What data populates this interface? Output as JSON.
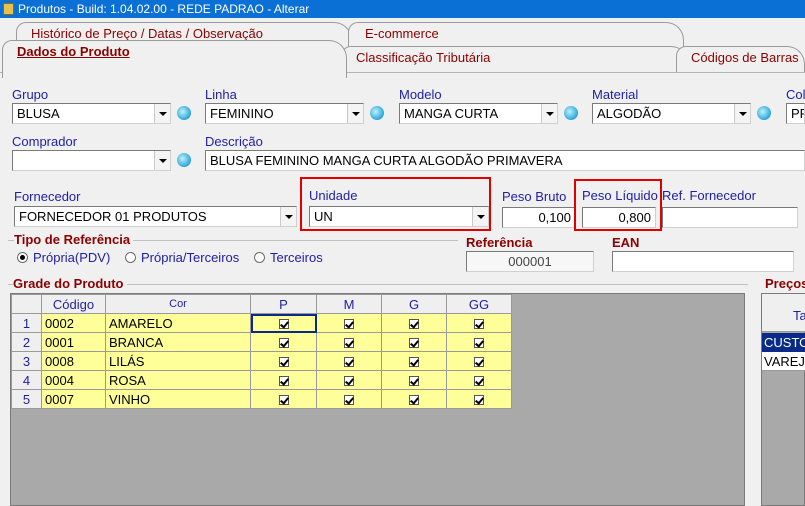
{
  "window": {
    "title": "Produtos - Build: 1.04.02.00 - REDE PADRAO - Alterar"
  },
  "tabs": {
    "historico": "Histórico de Preço / Datas / Observação",
    "ecommerce": "E-commerce",
    "dados": "Dados do Produto",
    "classificacao": "Classificação Tributária",
    "codigos": "Códigos de Barras"
  },
  "fields": {
    "grupo": {
      "label": "Grupo",
      "value": "BLUSA"
    },
    "linha": {
      "label": "Linha",
      "value": "FEMININO"
    },
    "modelo": {
      "label": "Modelo",
      "value": "MANGA CURTA"
    },
    "material": {
      "label": "Material",
      "value": "ALGODÃO"
    },
    "colecao": {
      "label": "Col",
      "value": "PR"
    },
    "comprador": {
      "label": "Comprador",
      "value": ""
    },
    "descricao": {
      "label": "Descrição",
      "value": "BLUSA FEMININO MANGA CURTA ALGODÃO PRIMAVERA"
    },
    "fornecedor": {
      "label": "Fornecedor",
      "value": "FORNECEDOR 01 PRODUTOS"
    },
    "unidade": {
      "label": "Unidade",
      "value": "UN"
    },
    "peso_bruto": {
      "label": "Peso Bruto",
      "value": "0,100"
    },
    "peso_liquido": {
      "label": "Peso Líquido",
      "value": "0,800"
    },
    "ref_fornecedor": {
      "label": "Ref. Fornecedor",
      "value": ""
    },
    "referencia": {
      "label": "Referência",
      "value": "000001"
    },
    "ean": {
      "label": "EAN",
      "value": ""
    }
  },
  "tipo_referencia": {
    "label": "Tipo de Referência",
    "options": [
      "Própria(PDV)",
      "Própria/Terceiros",
      "Terceiros"
    ],
    "selected": "Própria(PDV)"
  },
  "grade": {
    "label": "Grade do Produto",
    "columns": [
      "Código",
      "Cor",
      "P",
      "M",
      "G",
      "GG"
    ],
    "rows": [
      {
        "n": "1",
        "codigo": "0002",
        "cor": "AMARELO"
      },
      {
        "n": "2",
        "codigo": "0001",
        "cor": "BRANCA"
      },
      {
        "n": "3",
        "codigo": "0008",
        "cor": "LILÁS"
      },
      {
        "n": "4",
        "codigo": "0004",
        "cor": "ROSA"
      },
      {
        "n": "5",
        "codigo": "0007",
        "cor": "VINHO"
      }
    ]
  },
  "precos": {
    "label": "Preços",
    "header": "Ta",
    "rows": [
      "CUSTO",
      "VAREJ"
    ]
  },
  "colors": {
    "accent_red": "#e00000",
    "label_blue": "#1e1ea6",
    "title_label": "#8b0000",
    "grid_yellow": "#ffff99"
  }
}
